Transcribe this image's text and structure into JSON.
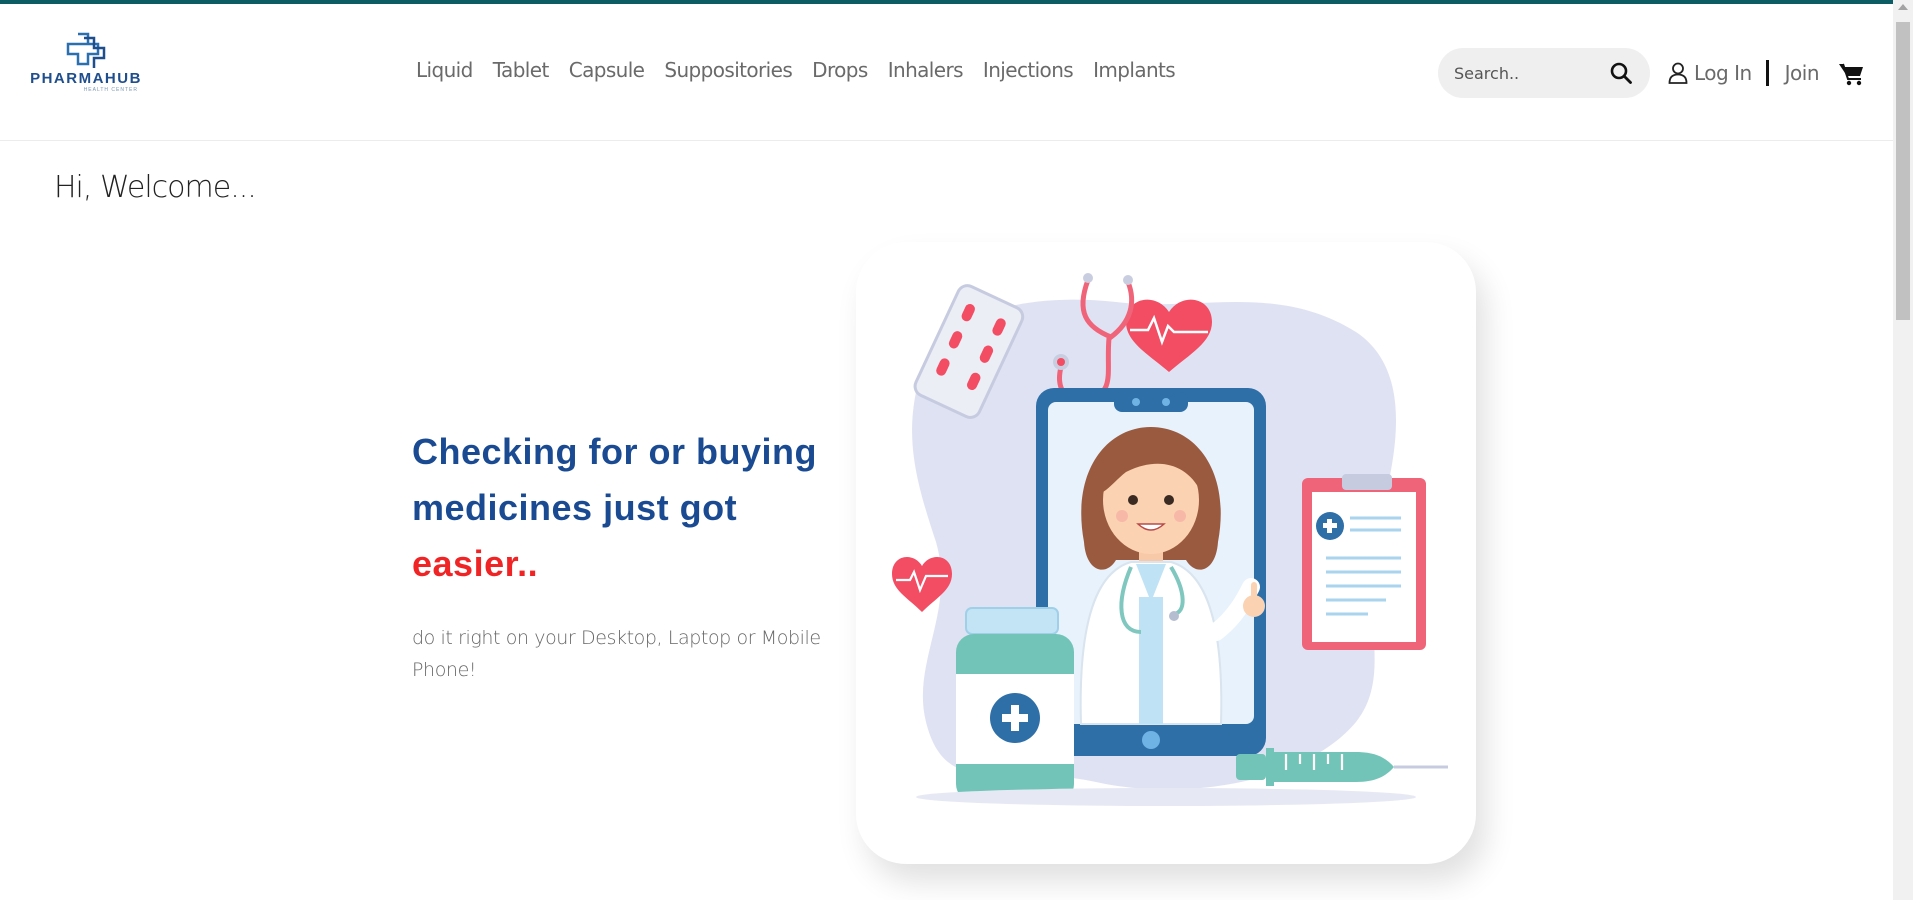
{
  "brand": {
    "name": "PHARMAHUB",
    "tagline": "HEALTH CENTER"
  },
  "nav": {
    "items": [
      {
        "label": "Liquid"
      },
      {
        "label": "Tablet"
      },
      {
        "label": "Capsule"
      },
      {
        "label": "Suppositories"
      },
      {
        "label": "Drops"
      },
      {
        "label": "Inhalers"
      },
      {
        "label": "Injections"
      },
      {
        "label": "Implants"
      }
    ]
  },
  "search": {
    "placeholder": "Search..",
    "icon": "search-icon"
  },
  "account": {
    "login_label": "Log In",
    "join_label": "Join",
    "user_icon": "user-icon",
    "cart_icon": "cart-icon"
  },
  "welcome": "Hi, Welcome...",
  "hero": {
    "headline_line1": "Checking for or buying",
    "headline_line2": "medicines just got",
    "headline_highlight": "easier..",
    "subtext": "do it right on your Desktop, Laptop or Mobile Phone!",
    "illustration": "doctor-on-phone-illustration"
  },
  "colors": {
    "brand_blue": "#1a4b92",
    "accent_red": "#f02424",
    "top_bar": "#0d5c63"
  }
}
